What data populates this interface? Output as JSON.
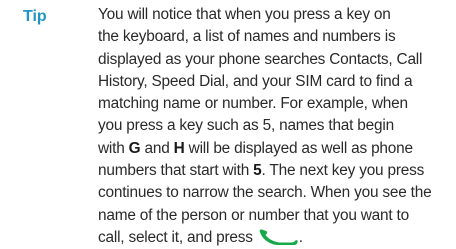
{
  "tip": {
    "label": "Tip",
    "lines": [
      "You will notice that when you press a key on",
      "the keyboard, a list of names and numbers is",
      "displayed as your phone searches Contacts, Call",
      "History, Speed Dial, and your SIM card to find a",
      "matching name or number. For example, when",
      "you press a key such as 5, names that begin"
    ],
    "line7": {
      "pre": "with ",
      "bold1": "G",
      "mid": " and ",
      "bold2": "H",
      "post": " will be displayed as well as phone"
    },
    "line8": {
      "pre": "numbers that start with ",
      "bold": "5",
      "post": ". The next key you press"
    },
    "lines_after": [
      "continues to narrow the search. When you see the",
      "name of the person or number that you want to"
    ],
    "final_line": {
      "pre": "call, select it, and press",
      "post": "."
    },
    "icon": "send-key-icon",
    "icon_color": "#17a84a",
    "label_color": "#2196c6"
  }
}
